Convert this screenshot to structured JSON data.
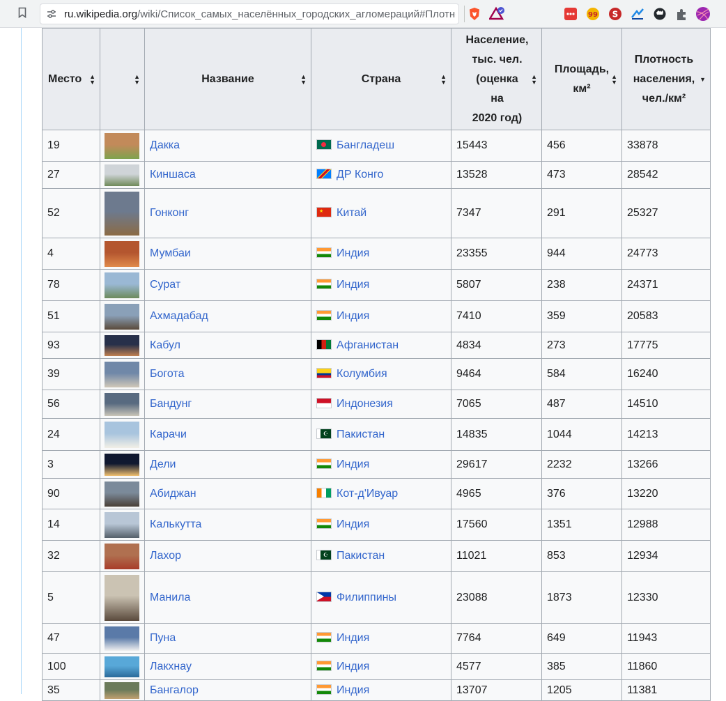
{
  "browser": {
    "url_host": "ru.wikipedia.org",
    "url_path": "/wiki/Список_самых_населённых_городских_агломераций#Плотно…",
    "extension_icons": [
      "bookmark-icon",
      "tune-icon",
      "brave-shield-icon",
      "bat-rewards-icon",
      "ext-red-icon",
      "ext-99-icon",
      "ext-s-icon",
      "ext-arrow-icon",
      "ext-github-icon",
      "puzzle-icon",
      "profile-avatar-icon"
    ]
  },
  "table": {
    "headers": {
      "rank": "Место",
      "image": "",
      "name": "Название",
      "country": "Страна",
      "population_l1": "Население,",
      "population_l2": "тыс. чел.",
      "population_l3": "(оценка",
      "population_l4": "на",
      "population_l5": "2020 год)",
      "area_l1": "Площадь,",
      "area_l2": "км²",
      "density_l1": "Плотность",
      "density_l2": "населения,",
      "density_l3": "чел./км²"
    },
    "rows": [
      {
        "rank": "19",
        "name": "Дакка",
        "country": "Бангладеш",
        "population": "15443",
        "area": "456",
        "density": "33878"
      },
      {
        "rank": "27",
        "name": "Киншаса",
        "country": "ДР Конго",
        "population": "13528",
        "area": "473",
        "density": "28542"
      },
      {
        "rank": "52",
        "name": "Гонконг",
        "country": "Китай",
        "population": "7347",
        "area": "291",
        "density": "25327"
      },
      {
        "rank": "4",
        "name": "Мумбаи",
        "country": "Индия",
        "population": "23355",
        "area": "944",
        "density": "24773"
      },
      {
        "rank": "78",
        "name": "Сурат",
        "country": "Индия",
        "population": "5807",
        "area": "238",
        "density": "24371"
      },
      {
        "rank": "51",
        "name": "Ахмадабад",
        "country": "Индия",
        "population": "7410",
        "area": "359",
        "density": "20583"
      },
      {
        "rank": "93",
        "name": "Кабул",
        "country": "Афганистан",
        "population": "4834",
        "area": "273",
        "density": "17775"
      },
      {
        "rank": "39",
        "name": "Богота",
        "country": "Колумбия",
        "population": "9464",
        "area": "584",
        "density": "16240"
      },
      {
        "rank": "56",
        "name": "Бандунг",
        "country": "Индонезия",
        "population": "7065",
        "area": "487",
        "density": "14510"
      },
      {
        "rank": "24",
        "name": "Карачи",
        "country": "Пакистан",
        "population": "14835",
        "area": "1044",
        "density": "14213"
      },
      {
        "rank": "3",
        "name": "Дели",
        "country": "Индия",
        "population": "29617",
        "area": "2232",
        "density": "13266"
      },
      {
        "rank": "90",
        "name": "Абиджан",
        "country": "Кот-д'Ивуар",
        "population": "4965",
        "area": "376",
        "density": "13220"
      },
      {
        "rank": "14",
        "name": "Калькутта",
        "country": "Индия",
        "population": "17560",
        "area": "1351",
        "density": "12988"
      },
      {
        "rank": "32",
        "name": "Лахор",
        "country": "Пакистан",
        "population": "11021",
        "area": "853",
        "density": "12934"
      },
      {
        "rank": "5",
        "name": "Манила",
        "country": "Филиппины",
        "population": "23088",
        "area": "1873",
        "density": "12330"
      },
      {
        "rank": "47",
        "name": "Пуна",
        "country": "Индия",
        "population": "7764",
        "area": "649",
        "density": "11943"
      },
      {
        "rank": "100",
        "name": "Лакхнау",
        "country": "Индия",
        "population": "4577",
        "area": "385",
        "density": "11860"
      },
      {
        "rank": "35",
        "name": "Бангалор",
        "country": "Индия",
        "population": "13707",
        "area": "1205",
        "density": "11381"
      }
    ]
  }
}
